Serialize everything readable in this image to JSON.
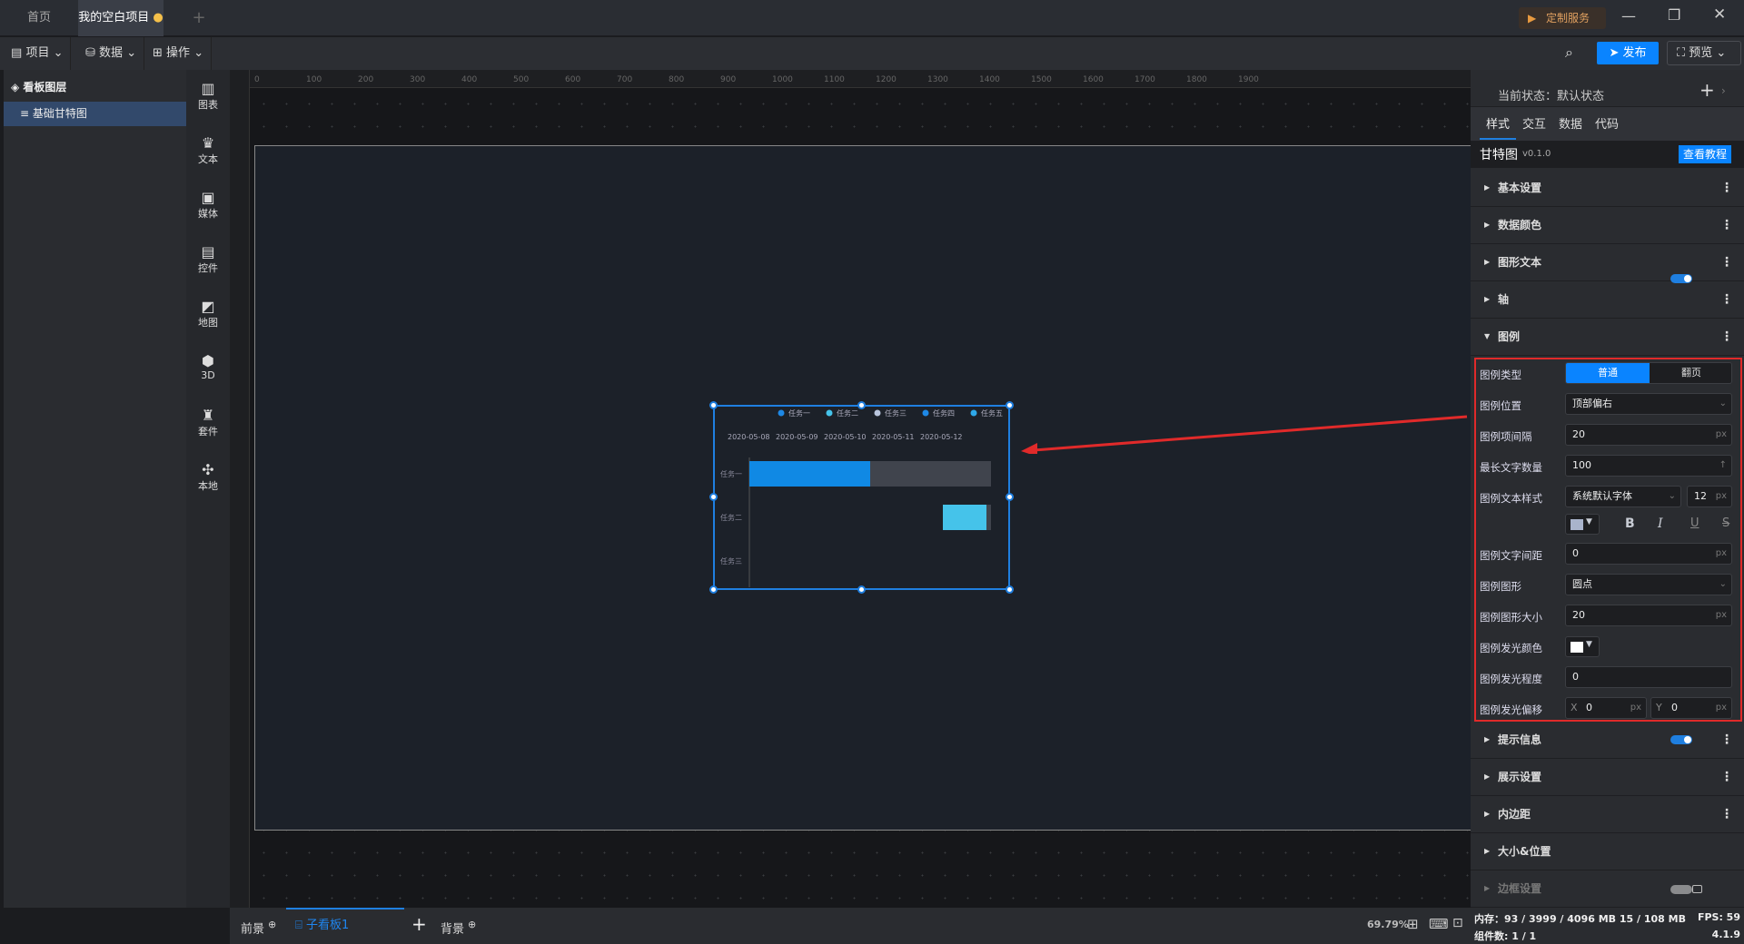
{
  "tabs": {
    "home": "首页",
    "project": "我的空白项目",
    "add": "+"
  },
  "custom_service": "定制服务",
  "toolbar": {
    "project": "项目",
    "data": "数据",
    "ops": "操作",
    "publish": "发布",
    "preview": "预览"
  },
  "layers": {
    "title": "看板图层",
    "items": [
      "基础甘特图"
    ]
  },
  "components": [
    "图表",
    "文本",
    "媒体",
    "控件",
    "地图",
    "3D",
    "套件",
    "本地"
  ],
  "ruler_ticks": [
    "0",
    "100",
    "200",
    "300",
    "400",
    "500",
    "600",
    "700",
    "800",
    "900",
    "1000",
    "1100",
    "1200",
    "1300",
    "1400",
    "1500",
    "1600",
    "1700",
    "1800",
    "1900"
  ],
  "chart": {
    "legend": [
      {
        "label": "任务一",
        "color": "#1e88e5"
      },
      {
        "label": "任务二",
        "color": "#45c3ea"
      },
      {
        "label": "任务三",
        "color": "#b8c4dc"
      },
      {
        "label": "任务四",
        "color": "#1e88e5"
      },
      {
        "label": "任务五",
        "color": "#2ea8e8"
      }
    ],
    "dates": [
      "2020-05-08",
      "2020-05-09",
      "2020-05-10",
      "2020-05-11",
      "2020-05-12"
    ],
    "tasks": [
      "任务一",
      "任务二",
      "任务三"
    ],
    "bar_colors": {
      "t1": "#1089e4",
      "t2": "#45c3ea",
      "track": "#40444d"
    }
  },
  "bottom": {
    "front": "前景",
    "board": "子看板1",
    "add": "+",
    "back": "背景",
    "zoom": "69.79%"
  },
  "right": {
    "state": "当前状态：默认状态",
    "tabs": [
      "样式",
      "交互",
      "数据",
      "代码"
    ],
    "comp_name": "甘特图",
    "version": "v0.1.0",
    "tutorial": "查看教程",
    "sections_top": [
      "基本设置",
      "数据颜色",
      "图形文本",
      "轴",
      "图例"
    ],
    "sections_bottom": [
      "提示信息",
      "展示设置",
      "内边距",
      "大小&位置",
      "边框设置"
    ],
    "legend": {
      "type_label": "图例类型",
      "type_options": [
        "普通",
        "翻页"
      ],
      "pos_label": "图例位置",
      "pos_value": "顶部偏右",
      "gap_label": "图例项间隔",
      "gap_value": "20",
      "maxlen_label": "最长文字数量",
      "maxlen_value": "100",
      "textstyle_label": "图例文本样式",
      "font_value": "系统默认字体",
      "font_size": "12",
      "text_color": "#a9b4cc",
      "bold": "B",
      "italic": "I",
      "underline": "U",
      "strike": "S",
      "letter_label": "图例文字间距",
      "letter_value": "0",
      "shape_label": "图例图形",
      "shape_value": "圆点",
      "shape_size_label": "图例图形大小",
      "shape_size_value": "20",
      "glow_color_label": "图例发光颜色",
      "glow_color": "#ffffff",
      "glow_level_label": "图例发光程度",
      "glow_level_value": "0",
      "glow_offset_label": "图例发光偏移",
      "x_label": "X",
      "x_value": "0",
      "y_label": "Y",
      "y_value": "0",
      "unit": "px"
    }
  },
  "status": {
    "memory": "内存：93 / 3999 / 4096 MB  15 / 108 MB",
    "fps": "FPS:  59",
    "count": "组件数: 1 / 1",
    "version": "4.1.9"
  }
}
